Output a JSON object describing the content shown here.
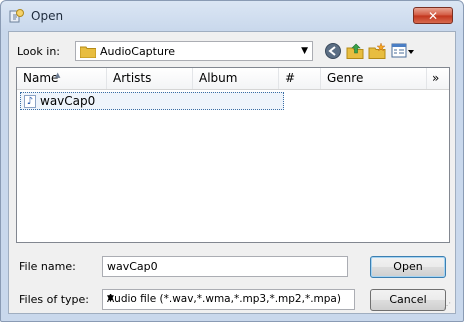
{
  "window": {
    "title": "Open",
    "close_label": "✕"
  },
  "toolbar": {
    "look_in_label": "Look in:",
    "look_in_value": "AudioCapture"
  },
  "list": {
    "columns": [
      "Name",
      "Artists",
      "Album",
      "#",
      "Genre",
      "»"
    ],
    "items": [
      {
        "name": "wavCap0"
      }
    ]
  },
  "footer": {
    "file_name_label": "File name:",
    "file_name_value": "wavCap0",
    "files_of_type_label": "Files of type:",
    "files_of_type_value": "Audio file (*.wav,*.wma,*.mp3,*.mp2,*.mpa)",
    "open_label": "Open",
    "cancel_label": "Cancel"
  },
  "colors": {
    "accent": "#3c7fb1",
    "frame": "#c9d8ec",
    "close": "#c2341c"
  }
}
